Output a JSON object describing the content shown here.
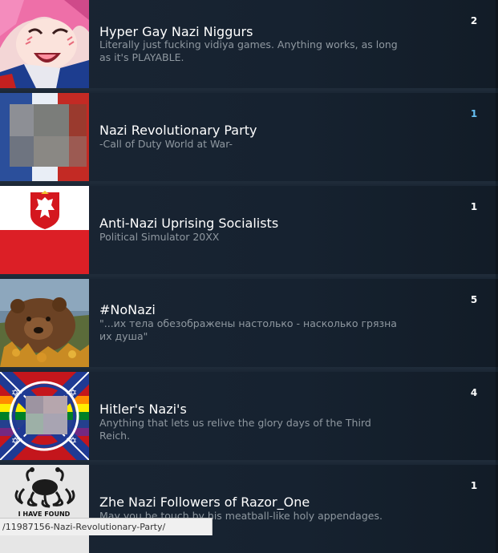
{
  "groups": [
    {
      "name": "Hyper Gay Nazi Niggurs",
      "description": "Literally just fucking vidiya games. Anything works, as long as it's PLAYABLE.",
      "count": "2",
      "avatar": "anime-girl-avatar"
    },
    {
      "name": "Nazi Revolutionary Party",
      "description": "-Call of Duty World at War-",
      "count": "1",
      "avatar": "blurred-flag-avatar"
    },
    {
      "name": "Anti-Nazi Uprising Socialists",
      "description": "Political Simulator 20XX",
      "count": "1",
      "avatar": "poland-flag-avatar"
    },
    {
      "name": "#NoNazi",
      "description": "\"...их тела обезображены настолько - насколько грязна их душа\"",
      "count": "5",
      "avatar": "bear-avatar"
    },
    {
      "name": "Hitler's Nazi's",
      "description": "Anything that lets us relive the glory days of the Third Reich.",
      "count": "4",
      "avatar": "flag-collage-avatar"
    },
    {
      "name": "Zhe Nazi Followers of Razor_One",
      "description": "May you be touch by his meatball-like holy appendages.",
      "count": "1",
      "avatar": "spaghetti-monster-avatar",
      "avatar_text": "I HAVE FOUND"
    }
  ],
  "status_bar": {
    "url": "/11987156-Nazi-Revolutionary-Party/"
  },
  "colors": {
    "highlight_count": "#66c0f4",
    "row_bg": "#1a2533",
    "text_primary": "#ffffff",
    "text_secondary": "#8f98a0"
  }
}
